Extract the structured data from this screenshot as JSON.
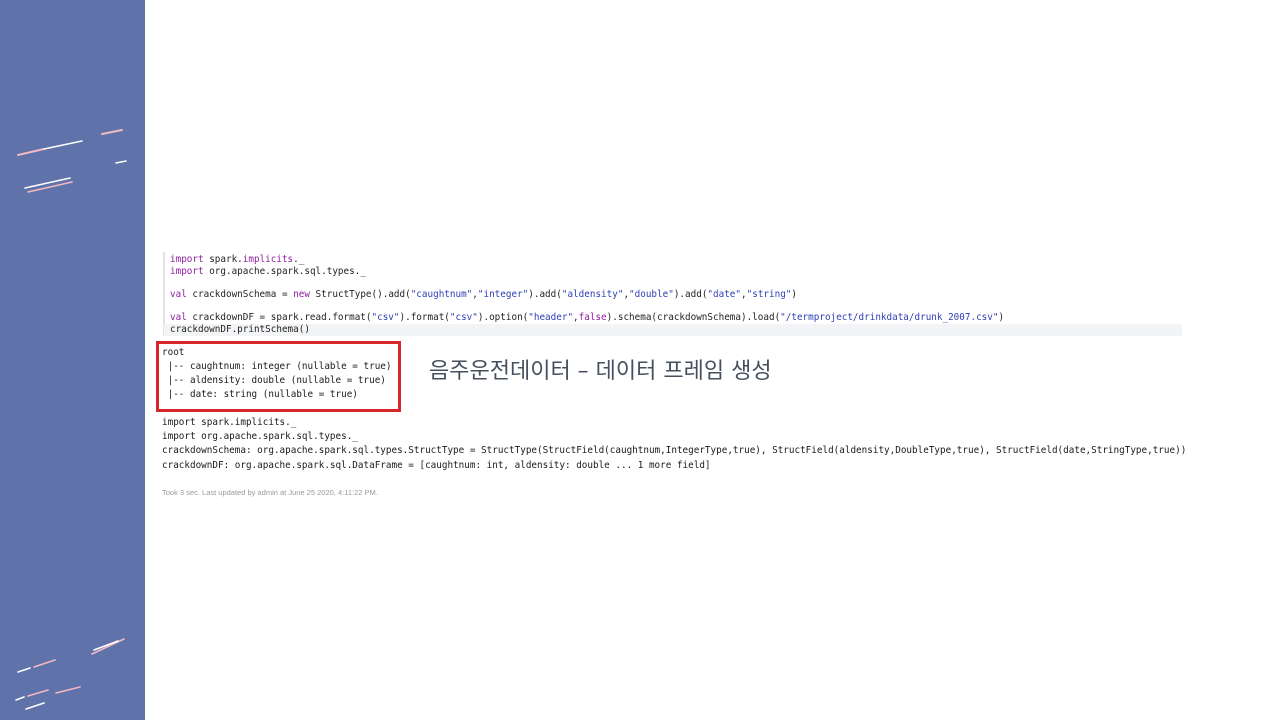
{
  "slide": {
    "accent_color": "#5f72aa",
    "highlight_color": "#d9262b",
    "caption": "음주운전데이터 – 데이터 프레임 생성"
  },
  "code_cell": {
    "lines": [
      [
        {
          "t": "import",
          "k": "kw"
        },
        {
          "t": " spark."
        },
        {
          "t": "implicits",
          "k": "kw"
        },
        {
          "t": "._"
        }
      ],
      [
        {
          "t": "import",
          "k": "kw"
        },
        {
          "t": " org.apache.spark.sql.types._"
        }
      ],
      [],
      [
        {
          "t": "val",
          "k": "kw"
        },
        {
          "t": " crackdownSchema = "
        },
        {
          "t": "new",
          "k": "kw"
        },
        {
          "t": " StructType().add("
        },
        {
          "t": "\"caughtnum\"",
          "k": "str"
        },
        {
          "t": ","
        },
        {
          "t": "\"integer\"",
          "k": "str"
        },
        {
          "t": ").add("
        },
        {
          "t": "\"aldensity\"",
          "k": "str"
        },
        {
          "t": ","
        },
        {
          "t": "\"double\"",
          "k": "str"
        },
        {
          "t": ").add("
        },
        {
          "t": "\"date\"",
          "k": "str"
        },
        {
          "t": ","
        },
        {
          "t": "\"string\"",
          "k": "str"
        },
        {
          "t": ")"
        }
      ],
      [],
      [
        {
          "t": "val",
          "k": "kw"
        },
        {
          "t": " crackdownDF = spark.read.format("
        },
        {
          "t": "\"csv\"",
          "k": "str"
        },
        {
          "t": ").format("
        },
        {
          "t": "\"csv\"",
          "k": "str"
        },
        {
          "t": ").option("
        },
        {
          "t": "\"header\"",
          "k": "str"
        },
        {
          "t": ","
        },
        {
          "t": "false",
          "k": "kw"
        },
        {
          "t": ").schema(crackdownSchema).load("
        },
        {
          "t": "\"/termproject/drinkdata/drunk_2007.csv\"",
          "k": "str"
        },
        {
          "t": ")"
        }
      ],
      [
        {
          "t": "crackdownDF.printSchema()"
        }
      ]
    ]
  },
  "output": {
    "schema_lines": [
      "root",
      " |-- caughtnum: integer (nullable = true)",
      " |-- aldensity: double (nullable = true)",
      " |-- date: string (nullable = true)"
    ],
    "result_lines": [
      "import spark.implicits._",
      "import org.apache.spark.sql.types._",
      "crackdownSchema: org.apache.spark.sql.types.StructType = StructType(StructField(caughtnum,IntegerType,true), StructField(aldensity,DoubleType,true), StructField(date,StringType,true))",
      "crackdownDF: org.apache.spark.sql.DataFrame = [caughtnum: int, aldensity: double ... 1 more field]"
    ],
    "status": "Took 3 sec. Last updated by admin at June 25 2020, 4:11:22 PM."
  }
}
